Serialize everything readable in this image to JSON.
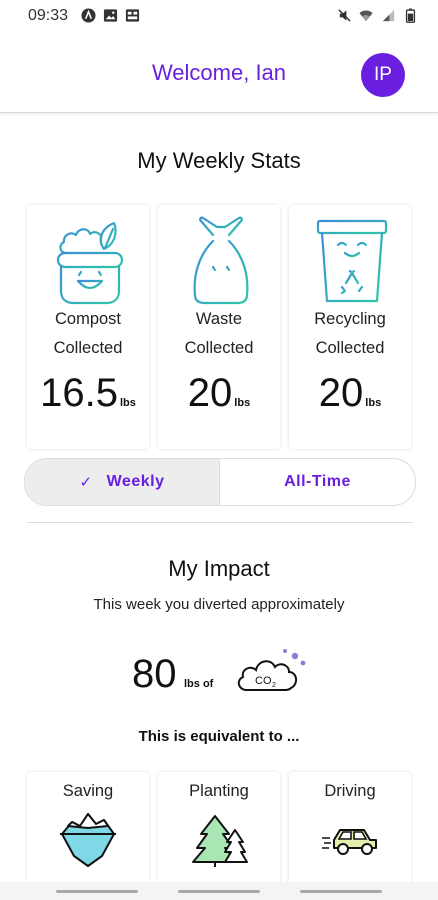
{
  "status_bar": {
    "time": "09:33",
    "left_icons": [
      "assistant-icon",
      "image-icon",
      "cast-icon"
    ],
    "right_icons": [
      "mute-icon",
      "wifi-icon",
      "signal-icon",
      "battery-icon"
    ]
  },
  "header": {
    "welcome": "Welcome, Ian",
    "avatar_initials": "IP"
  },
  "weekly_stats": {
    "title": "My Weekly Stats",
    "cards": [
      {
        "icon": "compost-bin-icon",
        "label_line1": "Compost",
        "label_line2": "Collected",
        "value": "16.5",
        "unit": "lbs"
      },
      {
        "icon": "waste-bag-icon",
        "label_line1": "Waste",
        "label_line2": "Collected",
        "value": "20",
        "unit": "lbs"
      },
      {
        "icon": "recycling-bin-icon",
        "label_line1": "Recycling",
        "label_line2": "Collected",
        "value": "20",
        "unit": "lbs"
      }
    ]
  },
  "toggle": {
    "weekly_label": "Weekly",
    "all_time_label": "All-Time",
    "selected": "Weekly"
  },
  "impact": {
    "title": "My Impact",
    "subtitle": "This week you diverted approximately",
    "co2_value": "80",
    "co2_unit": "lbs of",
    "co2_badge": "CO",
    "co2_badge_sub": "2",
    "equivalent": "This is equivalent to ..."
  },
  "equivalents": [
    {
      "label": "Saving",
      "icon": "iceberg-icon"
    },
    {
      "label": "Planting",
      "icon": "trees-icon"
    },
    {
      "label": "Driving",
      "icon": "car-icon"
    }
  ],
  "colors": {
    "accent": "#6a1fe0",
    "icon_gradient_start": "#3a9fd6",
    "icon_gradient_end": "#2fc6a6"
  }
}
